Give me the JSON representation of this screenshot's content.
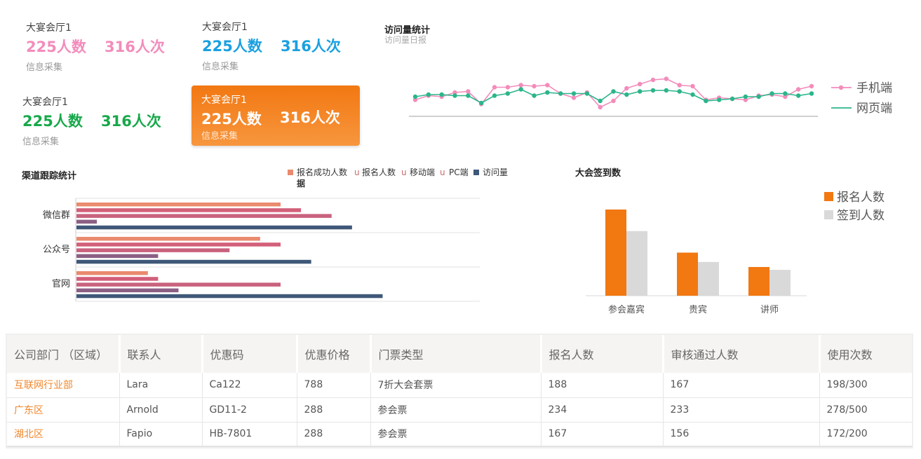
{
  "cards": [
    {
      "title": "大宴会厅1",
      "persons": "225人数",
      "visits": "316人次",
      "sub": "信息采集"
    },
    {
      "title": "大宴会厅1",
      "persons": "225人数",
      "visits": "316人次",
      "sub": "信息采集"
    },
    {
      "title": "大宴会厅1",
      "persons": "225人数",
      "visits": "316人次",
      "sub": "信息采集"
    },
    {
      "title": "大宴会厅1",
      "persons": "225人数",
      "visits": "316人次",
      "sub": "信息采集"
    }
  ],
  "colors": {
    "pink": "#f38cbb",
    "blue": "#1aa0e0",
    "green": "#17a84a",
    "orange": "#f27812",
    "teal": "#2bb58a"
  },
  "visit": {
    "title": "访问量统计",
    "subtitle": "访问量日报"
  },
  "channel": {
    "title": "渠道跟踪统计"
  },
  "signin": {
    "title": "大会签到数"
  },
  "chart_data": [
    {
      "type": "line",
      "x": [
        1,
        2,
        3,
        4,
        5,
        6,
        7,
        8,
        9,
        10,
        11,
        12,
        13,
        14,
        15,
        16,
        17,
        18,
        19,
        20,
        21,
        22,
        23,
        24,
        25,
        26,
        27,
        28,
        29,
        30,
        31
      ],
      "series": [
        {
          "name": "手机端",
          "color": "#f38cbb",
          "values": [
            40,
            44,
            43,
            47,
            48,
            36,
            52,
            52,
            54,
            53,
            54,
            46,
            42,
            47,
            33,
            39,
            51,
            55,
            59,
            60,
            54,
            53,
            40,
            42,
            41,
            40,
            44,
            45,
            43,
            50,
            53
          ]
        },
        {
          "name": "网页端",
          "color": "#2bb58a",
          "values": [
            43,
            45,
            45,
            44,
            44,
            37,
            44,
            46,
            50,
            44,
            47,
            46,
            46,
            46,
            39,
            48,
            45,
            48,
            49,
            49,
            48,
            45,
            39,
            40,
            41,
            43,
            43,
            46,
            46,
            44,
            46
          ]
        }
      ],
      "legend": "right"
    },
    {
      "type": "bar",
      "orientation": "horizontal",
      "categories": [
        "微信群",
        "公众号",
        "官网"
      ],
      "series": [
        {
          "name": "报名成功人数",
          "color": "#ea8a6e",
          "values": [
            200,
            180,
            70
          ]
        },
        {
          "name": "报名人数",
          "color": "#d25f79",
          "values": [
            220,
            200,
            80
          ]
        },
        {
          "name": "移动端",
          "color": "#c9627e",
          "values": [
            250,
            150,
            200
          ]
        },
        {
          "name": "PC端",
          "color": "#8c5f84",
          "values": [
            20,
            80,
            100
          ]
        },
        {
          "name": "访问量数据",
          "color": "#3f5879",
          "values": [
            270,
            230,
            300
          ]
        }
      ],
      "legend_entries": [
        "报名成功人数",
        "u",
        "报名人数",
        "u",
        "移动端",
        "u",
        "PC端",
        "访问量",
        "据"
      ],
      "legend": "top"
    },
    {
      "type": "bar",
      "categories": [
        "参会嘉宾",
        "贵宾",
        "讲师"
      ],
      "series": [
        {
          "name": "报名人数",
          "color": "#f27812",
          "values": [
            120,
            60,
            40
          ]
        },
        {
          "name": "签到人数",
          "color": "#d9d9d9",
          "values": [
            90,
            47,
            36
          ]
        }
      ],
      "legend": "right"
    }
  ],
  "table": {
    "headers": [
      "公司部门 （区域）",
      "联系人",
      "优惠码",
      "优惠价格",
      "门票类型",
      "报名人数",
      "审核通过人数",
      "使用次数"
    ],
    "rows": [
      [
        "互联网行业部",
        "Lara",
        "Ca122",
        "788",
        "7折大会套票",
        "188",
        "167",
        "198/300"
      ],
      [
        "广东区",
        "Arnold",
        "GD11-2",
        "288",
        "参会票",
        "234",
        "233",
        "278/500"
      ],
      [
        "湖北区",
        "Fapio",
        "HB-7801",
        "288",
        "参会票",
        "167",
        "156",
        "172/200"
      ]
    ]
  }
}
